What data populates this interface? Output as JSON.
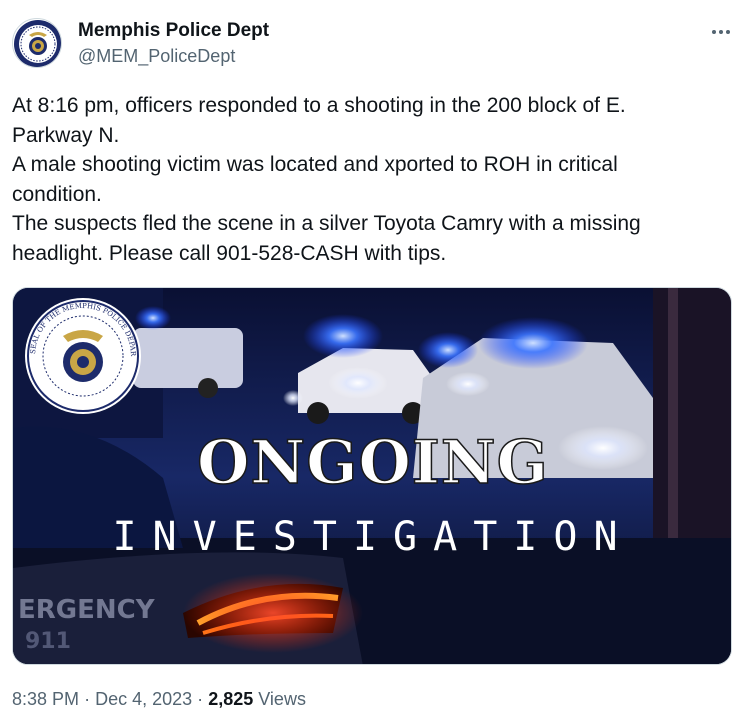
{
  "account": {
    "display_name": "Memphis Police Dept",
    "handle": "@MEM_PoliceDept",
    "avatar_icon": "police-seal-icon"
  },
  "menu": {
    "more_icon": "more-options-icon",
    "more_label": "···"
  },
  "tweet": {
    "lines": [
      "At 8:16 pm, officers responded to a shooting in the 200 block of E.",
      "Parkway N.",
      "A male shooting victim was located and xported to ROH in critical",
      "condition.",
      "The suspects fled the scene in a silver Toyota Camry with a missing",
      "headlight. Please call 901-528-CASH with tips."
    ]
  },
  "media": {
    "headline": "ONGOING",
    "subheadline": "INVESTIGATION",
    "seal_text": "SEAL OF THE MEMPHIS POLICE DEPARTMENT",
    "car_text": "ERGENCY",
    "car_number": "911"
  },
  "footer": {
    "time": "8:38 PM",
    "separator": "·",
    "date": "Dec 4, 2023",
    "views_count": "2,825",
    "views_label": "Views"
  },
  "colors": {
    "text_primary": "#0f1419",
    "text_secondary": "#536471",
    "police_blue": "#2f6bff",
    "night": "#0b1030"
  }
}
